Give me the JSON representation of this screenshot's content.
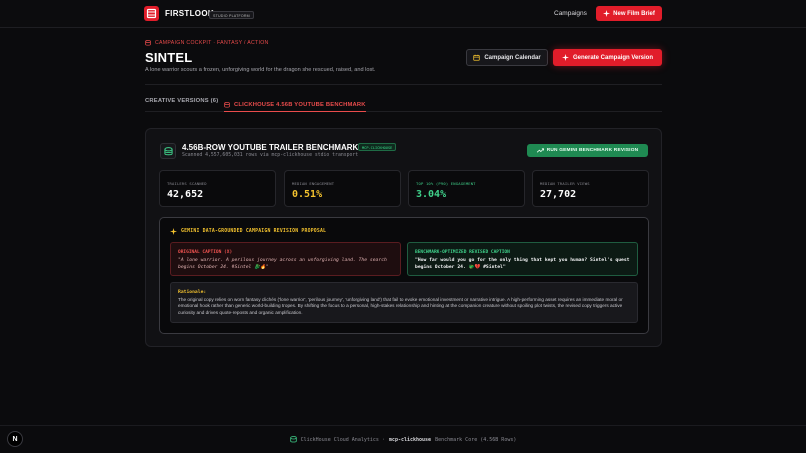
{
  "header": {
    "brand": "FIRSTLOOK",
    "tag": "STUDIO PLATFORM",
    "nav_campaigns": "Campaigns",
    "new_brief": "New Film Brief",
    "accent": "#e11d2a"
  },
  "page": {
    "breadcrumb": "CAMPAIGN COCKPIT · FANTASY / ACTION",
    "title": "SINTEL",
    "logline": "A lone warrior scours a frozen, unforgiving world for the dragon she rescued, raised, and lost.",
    "calendar_button": "Campaign Calendar",
    "generate_button": "Generate Campaign Version"
  },
  "tabs": {
    "creative": "CREATIVE VERSIONS (6)",
    "benchmark": "CLICKHOUSE 4.56B YOUTUBE BENCHMARK"
  },
  "panel": {
    "title": "4.56B-ROW YOUTUBE TRAILER BENCHMARK",
    "badge": "MCP-CLICKHOUSE",
    "subtitle": "Scanned 4,557,605,031 rows via mcp-clickhouse stdio transport",
    "run_button": "RUN GEMINI BENCHMARK REVISION",
    "stats": [
      {
        "label": "TRAILERS SCANNED",
        "value": "42,652",
        "color": "#ffffff"
      },
      {
        "label": "MEDIAN ENGAGEMENT",
        "value": "0.51%",
        "color": "#f2c12e"
      },
      {
        "label": "TOP 10% (P90) ENGAGEMENT",
        "value": "3.04%",
        "color": "#3fd08a"
      },
      {
        "label": "MEDIAN TRAILER VIEWS",
        "value": "27,702",
        "color": "#ffffff"
      }
    ]
  },
  "proposal": {
    "title": "GEMINI DATA-GROUNDED CAMPAIGN REVISION PROPOSAL",
    "original_label": "ORIGINAL CAPTION (X)",
    "original_text": "\"A lone warrior. A perilous journey across an unforgiving land. The search begins October 24. #Sintel 🐉🔥\"",
    "revised_label": "BENCHMARK-OPTIMIZED REVISED CAPTION",
    "revised_text": "\"How far would you go for the only thing that kept you human? Sintel's quest begins October 24. 🐲💔 #Sintel\"",
    "rationale_label": "Rationale:",
    "rationale_text": "The original copy relies on worn fantasy clichés ('lone warrior', 'perilous journey', 'unforgiving land') that fail to evoke emotional investment or narrative intrigue. A high-performing asset requires an immediate moral or emotional hook rather than generic world-building tropes. By shifting the focus to a personal, high-stakes relationship and hinting at the companion creature without spoiling plot twists, the revised copy triggers active curiosity and drives quote-reposts and organic amplification."
  },
  "footer": {
    "prefix": "ClickHouse Cloud Analytics · ",
    "strong": "mcp-clickhouse",
    "suffix": " Benchmark Core (4.56B Rows)"
  },
  "badge_letter": "N"
}
